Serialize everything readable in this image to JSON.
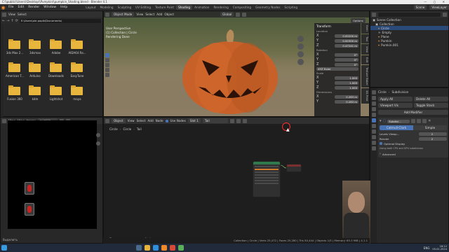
{
  "titlebar": {
    "text": "C:\\\\public\\\\Users\\\\Desktop\\\\Pumpkin\\\\pumpkin_Shading.blend - Blender 4.1",
    "controls": "— ▢ ✕"
  },
  "menubar": {
    "items": [
      "File",
      "Edit",
      "Render",
      "Window",
      "Help"
    ],
    "workspaces": [
      "Layout",
      "Modeling",
      "Sculpting",
      "UV Editing",
      "Texture Paint",
      "Shading",
      "Animation",
      "Rendering",
      "Compositing",
      "Geometry Nodes",
      "Scripting"
    ],
    "active_workspace": "Shading",
    "scene": "Scene",
    "view_layer": "ViewLayer"
  },
  "filebrowser": {
    "header": {
      "view": "View",
      "select": "Select"
    },
    "path": "E:\\Users\\ole.popik\\Documents\\",
    "folders": [
      "3ds Max 2...",
      "3dsmax",
      "Adobe",
      "AIDA64 Ra...",
      "American T...",
      "Arduino",
      "Downloads",
      "EasyTune",
      "Fusion 360",
      "kdm",
      "Lightshot",
      "maya"
    ]
  },
  "viewport": {
    "mode": "Object Mode",
    "menu": [
      "View",
      "Select",
      "Add",
      "Object"
    ],
    "orientation": "Global",
    "info1": "User Perspective",
    "info2": "(1) Collection | Circle",
    "info3": "Rendering Done",
    "options": "Options"
  },
  "npanel": {
    "title": "Transform",
    "location": "Location",
    "loc": [
      {
        "axis": "X",
        "val": "0.00200 m"
      },
      {
        "axis": "Y",
        "val": "0.00300 m"
      },
      {
        "axis": "Z",
        "val": "0.47241 m"
      }
    ],
    "rotation": "Rotation",
    "rot": [
      {
        "axis": "X",
        "val": "0°"
      },
      {
        "axis": "Y",
        "val": "0°"
      },
      {
        "axis": "Z",
        "val": "0°"
      }
    ],
    "euler": "XYZ Euler",
    "scale": "Scale",
    "scl": [
      {
        "axis": "X",
        "val": "1.000"
      },
      {
        "axis": "Y",
        "val": "1.000"
      },
      {
        "axis": "Z",
        "val": "1.000"
      }
    ],
    "dimensions": "Dimensions",
    "dim": [
      {
        "axis": "X",
        "val": "0.263 m"
      },
      {
        "axis": "Y",
        "val": "0.263 m"
      }
    ],
    "tabs": [
      "Item",
      "Tool",
      "View",
      "Edit",
      "Texture Baker",
      "3D-Print"
    ]
  },
  "imageeditor": {
    "menu": [
      "View",
      "View",
      "Image"
    ],
    "image_name": "pumkin",
    "footer": "Выделить"
  },
  "nodeeditor": {
    "type": "Object",
    "menu": [
      "View",
      "Select",
      "Add",
      "Node"
    ],
    "use_nodes": "Use Nodes",
    "slot": "Slot 1",
    "material": "Tail",
    "breadcrumb": [
      "Circle",
      "Circle",
      "Tail"
    ],
    "footer": "Панорамировать вид",
    "footer2": "Node"
  },
  "outliner": {
    "title": "Scene Collection",
    "rows": [
      {
        "label": "Collection",
        "sel": false
      },
      {
        "label": "Circle",
        "sel": true
      },
      {
        "label": "Empty",
        "sel": false
      },
      {
        "label": "Plane",
        "sel": false
      },
      {
        "label": "Pumkin",
        "sel": false
      },
      {
        "label": "Pumkin.001",
        "sel": false
      }
    ]
  },
  "properties": {
    "object": "Circle",
    "modifier_tab": "Subdivision",
    "apply_all": "Apply All",
    "delete_all": "Delete All",
    "viewport_vis": "Viewport Vis",
    "toggle_stack": "Toggle Stack",
    "add_modifier": "Add Modifier",
    "mod_name": "Subdivi...",
    "catmull": "Catmull-Clark",
    "simple": "Simple",
    "levels_viewport": "Levels Viewp...",
    "levels_val": "2",
    "render": "Render",
    "render_val": "2",
    "optimal": "Optimal Display",
    "gpu": "Using both CPU and GPU subdivision",
    "advanced": "Advanced"
  },
  "statusbar": {
    "text": "Collection | Circle | Verts 25,472 | Faces 25,280 | Tris 50,444 | Objects 1/5 | Memory: 65.3 MiB | 4.1.1"
  },
  "taskbar": {
    "time": "18:12",
    "date": "05.01.2024",
    "lang": "ENG"
  },
  "colors": {
    "accent": "#4772b3",
    "orange": "#ef8a2c",
    "highlight": "#ff2a2a"
  }
}
